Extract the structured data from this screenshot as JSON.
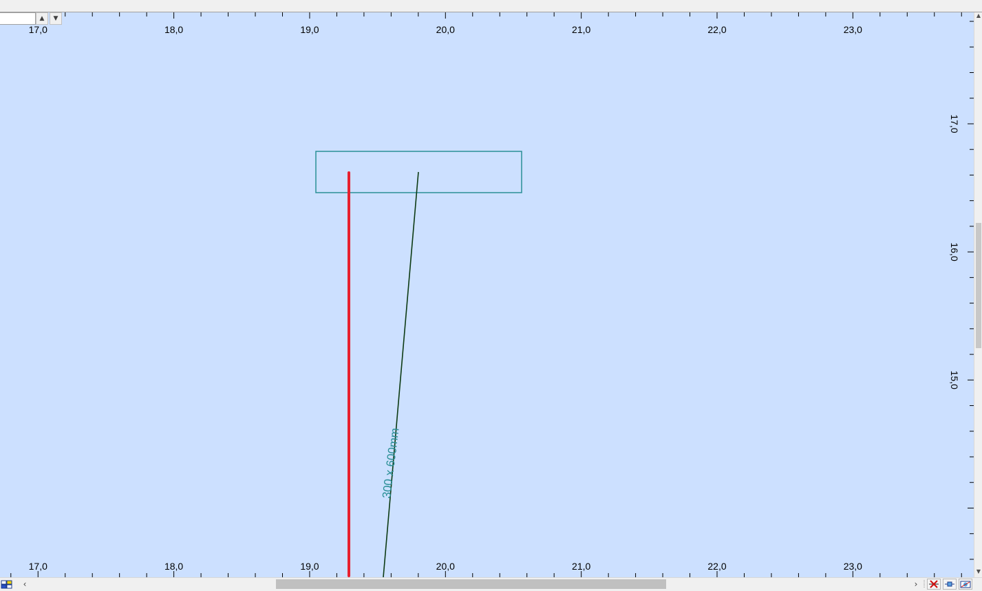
{
  "drawing": {
    "x_axis": {
      "ticks": [
        "17,0",
        "18,0",
        "19,0",
        "20,0",
        "21,0",
        "22,0",
        "23,0"
      ],
      "range": [
        16.72,
        23.89
      ]
    },
    "y_axis": {
      "ticks": [
        "17,0",
        "16,0",
        "15,0"
      ],
      "range": [
        13.46,
        17.87
      ]
    },
    "column_label": "300 x 600mm",
    "colors": {
      "background": "#cce0ff",
      "rectangle": "#2a8f96",
      "red_line": "#e8202f",
      "slanted_line": "#0c3a12",
      "label": "#2a8f96",
      "axis_text": "#000000"
    }
  },
  "toolbar": {
    "spin_up_glyph": "▲",
    "spin_down_glyph": "▼",
    "tool_icons": [
      "delete-icon",
      "measure-icon",
      "view-icon"
    ]
  },
  "scrollbars": {
    "left_arrow": "‹",
    "right_arrow": "›",
    "up_arrow": "▲",
    "down_arrow": "▼",
    "horizontal_position": 0.35,
    "vertical_position": 0.37
  }
}
